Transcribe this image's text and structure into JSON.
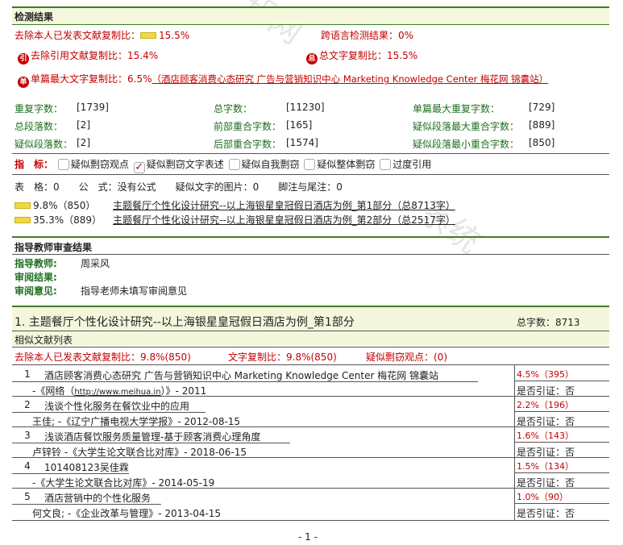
{
  "detection": {
    "section_title": "检测结果",
    "excl_self_label": "去除本人已发表文献复制比：",
    "excl_self_value": "15.5%",
    "cross_lang_label": "跨语言检测结果：",
    "cross_lang_value": "0%",
    "excl_cite_badge": "引",
    "excl_cite_label": "去除引用文献复制比：",
    "excl_cite_value": "15.4%",
    "total_copy_badge": "总",
    "total_copy_label": "总文字复制比：",
    "total_copy_value": "15.5%",
    "single_badge": "单",
    "single_label": "单篇最大文字复制比：",
    "single_value": "6.5%",
    "single_source": "（酒店顾客消费心态研究 广告与营销知识中心 Marketing Knowledge Center 梅花网 锦囊站）"
  },
  "stats": [
    {
      "label": "重复字数：",
      "value": "[1739]"
    },
    {
      "label": "总字数：",
      "value": "[11230]"
    },
    {
      "label": "单篇最大重复字数：",
      "value": "[729]"
    },
    {
      "label": "总段落数：",
      "value": "[2]"
    },
    {
      "label": "前部重合字数：",
      "value": "[165]"
    },
    {
      "label": "疑似段落最大重合字数：",
      "value": "[889]"
    },
    {
      "label": "疑似段落数：",
      "value": "[2]"
    },
    {
      "label": "后部重合字数：",
      "value": "[1574]"
    },
    {
      "label": "疑似段落最小重合字数：",
      "value": "[850]"
    }
  ],
  "indicators": {
    "label": "指　标：",
    "items": [
      {
        "text": "疑似剽窃观点",
        "checked": false
      },
      {
        "text": "疑似剽窃文字表述",
        "checked": true
      },
      {
        "text": "疑似自我剽窃",
        "checked": false
      },
      {
        "text": "疑似整体剽窃",
        "checked": false
      },
      {
        "text": "过度引用",
        "checked": false
      }
    ]
  },
  "counts_line": "表　格：0　　公　式：没有公式　　疑似文字的图片：0　　脚注与尾注：0",
  "parts": [
    {
      "pct": "9.8%（850）",
      "title": "主题餐厅个性化设计研究--以上海银星皇冠假日酒店为例_第1部分（总8713字）"
    },
    {
      "pct": "35.3%（889）",
      "title": "主题餐厅个性化设计研究--以上海银星皇冠假日酒店为例_第2部分（总2517字）"
    }
  ],
  "review": {
    "section_title": "指导教师审查结果",
    "teacher_label": "指导教师:",
    "teacher_value": "周采风",
    "result_label": "审阅结果:",
    "opinion_label": "审阅意见:",
    "opinion_value": "指导老师未填写审阅意见"
  },
  "part1": {
    "title": "1. 主题餐厅个性化设计研究--以上海银星皇冠假日酒店为例_第1部分",
    "total_words": "总字数：8713",
    "similar_list_title": "相似文献列表",
    "summary_excl_self": "去除本人已发表文献复制比：9.8%(850)",
    "summary_copy": "文字复制比：9.8%(850)",
    "summary_plag": "疑似剽窃观点：(0)"
  },
  "references": [
    {
      "num": "1",
      "title": "酒店顾客消费心态研究 广告与营销知识中心 Marketing Knowledge Center 梅花网 锦囊站",
      "source_pre": "-《网络（",
      "source_link": "http://www.meihua.in",
      "source_post": "）》- 2011",
      "pct": "4.5%（395）",
      "cite": "是否引证：否"
    },
    {
      "num": "2",
      "title": "浅谈个性化服务在餐饮业中的应用",
      "source": "王佳; -《辽宁广播电视大学学报》- 2012-08-15",
      "pct": "2.2%（196）",
      "cite": "是否引证：否"
    },
    {
      "num": "3",
      "title": "浅谈酒店餐饮服务质量管理-基于顾客消费心理角度",
      "source": "卢锌铃 -《大学生论文联合比对库》- 2018-06-15",
      "pct": "1.6%（143）",
      "cite": "是否引证：否"
    },
    {
      "num": "4",
      "title": "101408123吴佳霖",
      "source": "-《大学生论文联合比对库》- 2014-05-19",
      "pct": "1.5%（134）",
      "cite": "是否引证：否"
    },
    {
      "num": "5",
      "title": "酒店营销中的个性化服务",
      "source": "何文良; -《企业改革与管理》- 2013-04-15",
      "pct": "1.0%（90）",
      "cite": "是否引证：否"
    }
  ],
  "page_number": "- 1 -",
  "colors": {
    "accent_red": "#c40000",
    "line_green": "#3c7d24",
    "band": "#f4f7dc",
    "bar_yellow": "#f0d840"
  }
}
